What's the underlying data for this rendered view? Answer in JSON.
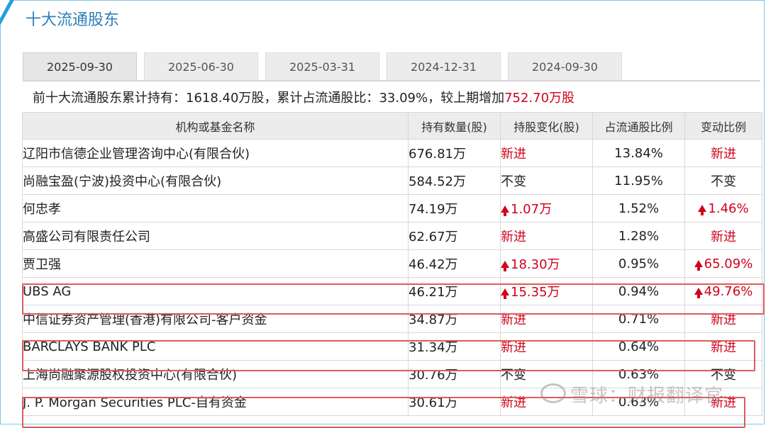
{
  "title": "十大流通股东",
  "tabs": [
    {
      "label": "2025-09-30",
      "active": true
    },
    {
      "label": "2025-06-30",
      "active": false
    },
    {
      "label": "2025-03-31",
      "active": false
    },
    {
      "label": "2024-12-31",
      "active": false
    },
    {
      "label": "2024-09-30",
      "active": false
    }
  ],
  "summary": {
    "prefix": "前十大流通股东累计持有：",
    "total_holding": "1618.40万股",
    "ratio_label": "，累计占流通股比：",
    "ratio": "33.09%",
    "change_label": "，较上期增加",
    "change": "752.70万股"
  },
  "table": {
    "headers": [
      "机构或基金名称",
      "持有数量(股)",
      "持股变化(股)",
      "占流通股比例",
      "变动比例"
    ],
    "rows": [
      {
        "name": "辽阳市信德企业管理咨询中心(有限合伙)",
        "holding": "676.81万",
        "change": "新进",
        "change_up": false,
        "change_red": true,
        "ratio": "13.84%",
        "vchange": "新进",
        "vchange_up": false,
        "vchange_red": true
      },
      {
        "name": "尚融宝盈(宁波)投资中心(有限合伙)",
        "holding": "584.52万",
        "change": "不变",
        "change_up": false,
        "change_red": false,
        "ratio": "11.95%",
        "vchange": "不变",
        "vchange_up": false,
        "vchange_red": false
      },
      {
        "name": "何忠孝",
        "holding": "74.19万",
        "change": "1.07万",
        "change_up": true,
        "change_red": true,
        "ratio": "1.52%",
        "vchange": "1.46%",
        "vchange_up": true,
        "vchange_red": true
      },
      {
        "name": "高盛公司有限责任公司",
        "holding": "62.67万",
        "change": "新进",
        "change_up": false,
        "change_red": true,
        "ratio": "1.28%",
        "vchange": "新进",
        "vchange_up": false,
        "vchange_red": true
      },
      {
        "name": "贾卫强",
        "holding": "46.42万",
        "change": "18.30万",
        "change_up": true,
        "change_red": true,
        "ratio": "0.95%",
        "vchange": "65.09%",
        "vchange_up": true,
        "vchange_red": true
      },
      {
        "name": "UBS AG",
        "holding": "46.21万",
        "change": "15.35万",
        "change_up": true,
        "change_red": true,
        "ratio": "0.94%",
        "vchange": "49.76%",
        "vchange_up": true,
        "vchange_red": true
      },
      {
        "name": "中信证券资产管理(香港)有限公司-客户资金",
        "holding": "34.87万",
        "change": "新进",
        "change_up": false,
        "change_red": true,
        "ratio": "0.71%",
        "vchange": "新进",
        "vchange_up": false,
        "vchange_red": true
      },
      {
        "name": "BARCLAYS BANK PLC",
        "holding": "31.34万",
        "change": "新进",
        "change_up": false,
        "change_red": true,
        "ratio": "0.64%",
        "vchange": "新进",
        "vchange_up": false,
        "vchange_red": true
      },
      {
        "name": "上海尚融聚源股权投资中心(有限合伙)",
        "holding": "30.76万",
        "change": "不变",
        "change_up": false,
        "change_red": false,
        "ratio": "0.63%",
        "vchange": "不变",
        "vchange_up": false,
        "vchange_red": false
      },
      {
        "name": "J. P. Morgan Securities PLC-自有资金",
        "holding": "30.61万",
        "change": "新进",
        "change_up": false,
        "change_red": true,
        "ratio": "0.63%",
        "vchange": "新进",
        "vchange_up": false,
        "vchange_red": true
      }
    ]
  },
  "watermark": "雪球：财报翻译官",
  "colors": {
    "accent": "#2f7fb8",
    "up": "#d0021b",
    "highlight_border": "#e05a5a"
  }
}
